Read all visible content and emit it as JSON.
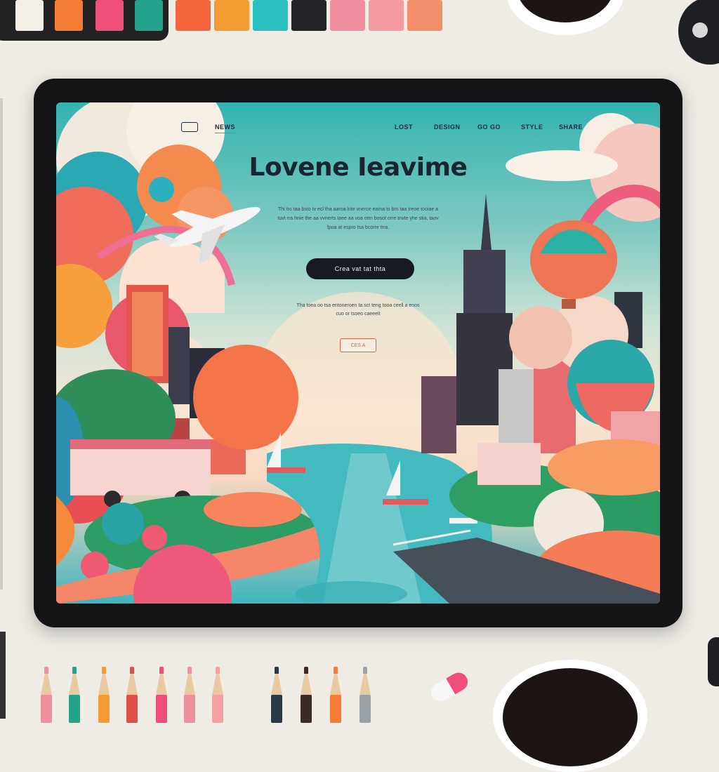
{
  "palette": [
    "#f3efe6",
    "#f47c35",
    "#ef4d7a",
    "#23a38c",
    "#f5663e",
    "#f39a32",
    "#2bbfbf",
    "#222428",
    "#ef8fa0",
    "#f59aa0",
    "#f38d6a"
  ],
  "nav": {
    "items": [
      "NEWS",
      "LOST",
      "DESIGN",
      "GO GO",
      "STYLE",
      "SHARE"
    ],
    "active": "NEWS"
  },
  "hero": {
    "title": "Lovene Ieavime",
    "text": "Thi tro taa bsto tv ecl tha aaroa lnte vnerce eatna ts bro taa treoe tooiae a tuvt rra hnie the aa vvnerts taee aa voa otrn bosot orre tnvte yhe stia, taov fpoa at espro tsa bcorre trra.",
    "cta": "Crea vat tat thta",
    "sub_text": "Tha toea oo tsa entoneroen ta sct teng tooa ceell a enos cuo or tsoeo caeeelt",
    "small_button": "CES A"
  },
  "colors": {
    "accent": "#e8603c",
    "dark": "#171a21"
  }
}
